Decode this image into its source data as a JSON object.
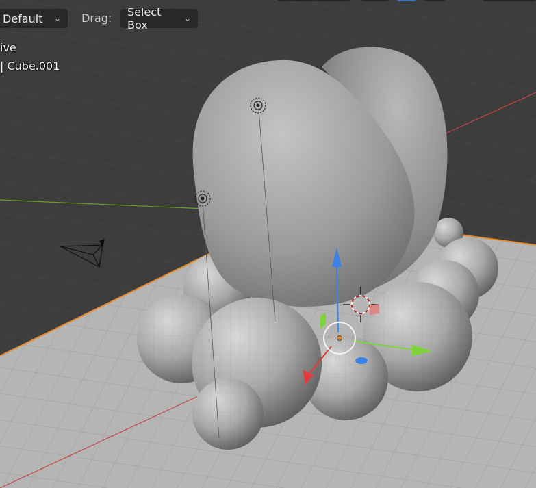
{
  "header": {
    "orientation_label": "Default",
    "drag_label": "Drag:",
    "drag_value": "Select Box"
  },
  "overlay": {
    "mode_text": "ive",
    "collection_text": "| Cube.001"
  },
  "colors": {
    "viewport_bg": "#3d3d3d",
    "grid": "#4a4a4a",
    "floor": "#b5b5b5",
    "selection_outline": "#e8892b",
    "x_axis": "#c44545",
    "y_axis": "#6a9e2a",
    "gizmo_z": "#3a82e6",
    "gizmo_x": "#e23b3b",
    "gizmo_y": "#7cd43a"
  },
  "icons": {
    "camera": "camera-object-icon",
    "light_1": "light-object-icon",
    "light_2": "light-object-icon",
    "cursor_3d": "3d-cursor-icon",
    "origin": "object-origin-icon"
  }
}
